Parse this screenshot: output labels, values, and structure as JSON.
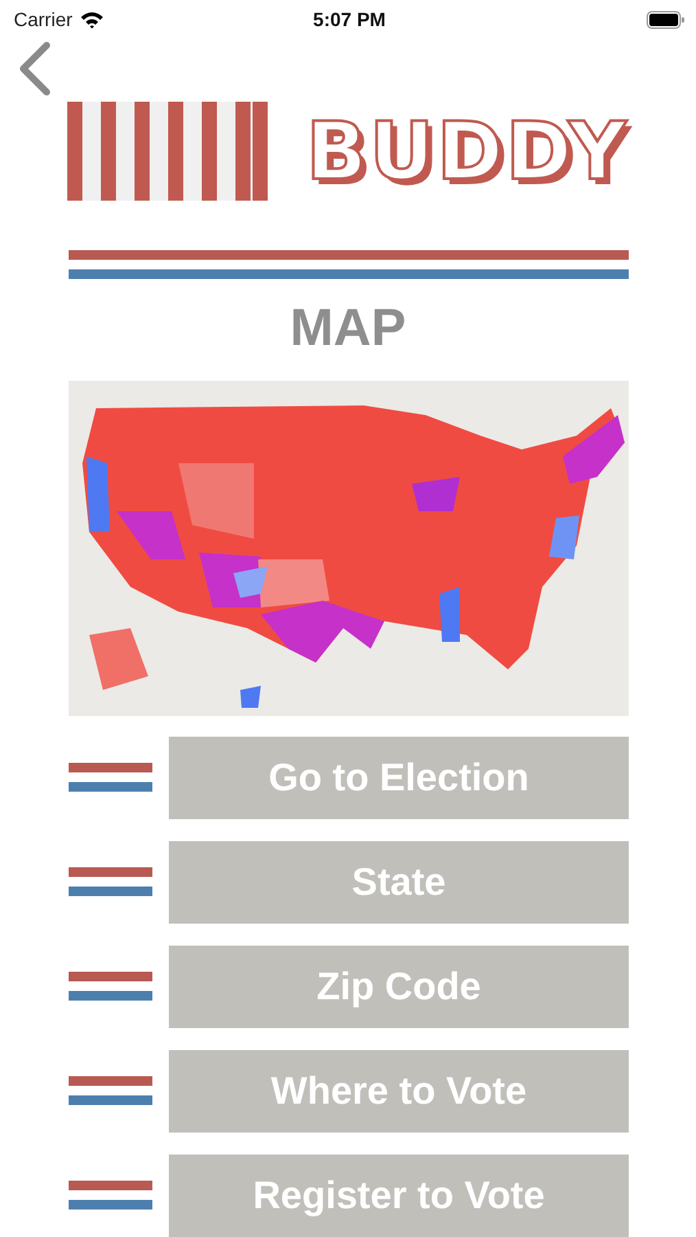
{
  "status_bar": {
    "carrier": "Carrier",
    "time": "5:07 PM"
  },
  "logo": {
    "text": "BUDDY"
  },
  "title": "MAP",
  "buttons": [
    "Go to Election",
    "State",
    "Zip Code",
    "Where to Vote",
    "Register to Vote"
  ]
}
